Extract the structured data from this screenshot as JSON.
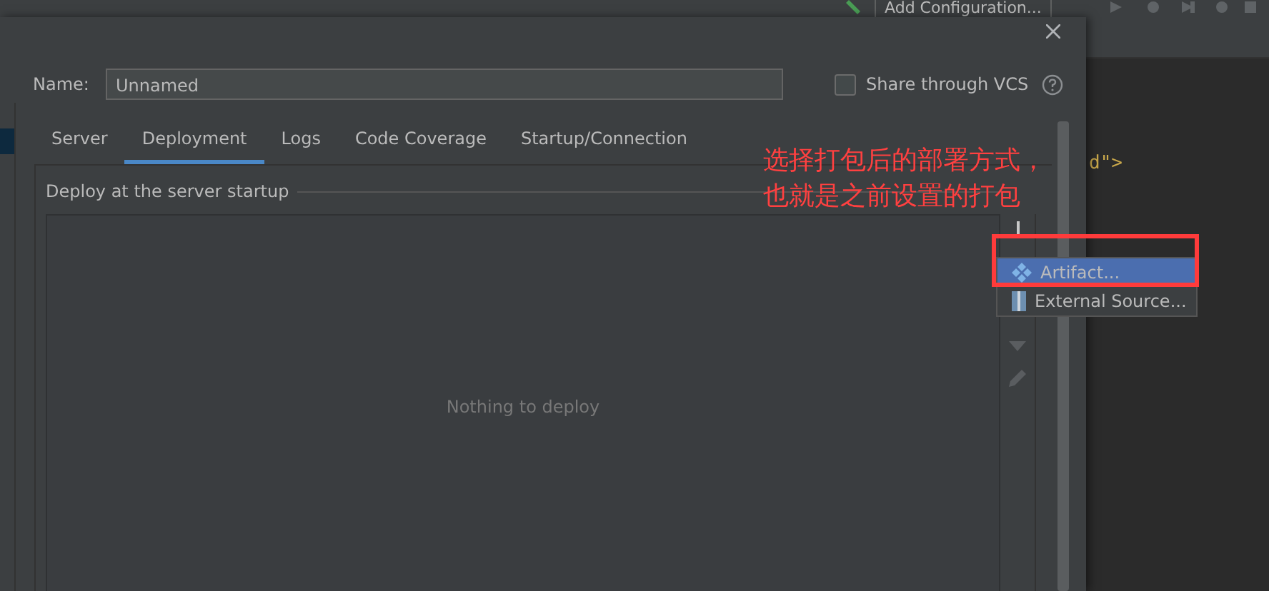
{
  "ide": {
    "run_configuration": "Add Configuration...",
    "code_fragment": "d\">"
  },
  "dialog": {
    "name_label": "Name:",
    "name_value": "Unnamed",
    "share_vcs": {
      "label": "Share through VCS",
      "checked": false
    },
    "tabs": [
      {
        "label": "Server",
        "selected": false
      },
      {
        "label": "Deployment",
        "selected": true
      },
      {
        "label": "Logs",
        "selected": false
      },
      {
        "label": "Code Coverage",
        "selected": false
      },
      {
        "label": "Startup/Connection",
        "selected": false
      }
    ],
    "section_title": "Deploy at the server startup",
    "empty_text": "Nothing to deploy"
  },
  "menu": [
    {
      "label": "Artifact...",
      "selected": true
    },
    {
      "label": "External Source...",
      "selected": false
    }
  ],
  "annotation": {
    "lines": [
      "选择打包后的部署方式，",
      "也就是之前设置的打包"
    ]
  }
}
